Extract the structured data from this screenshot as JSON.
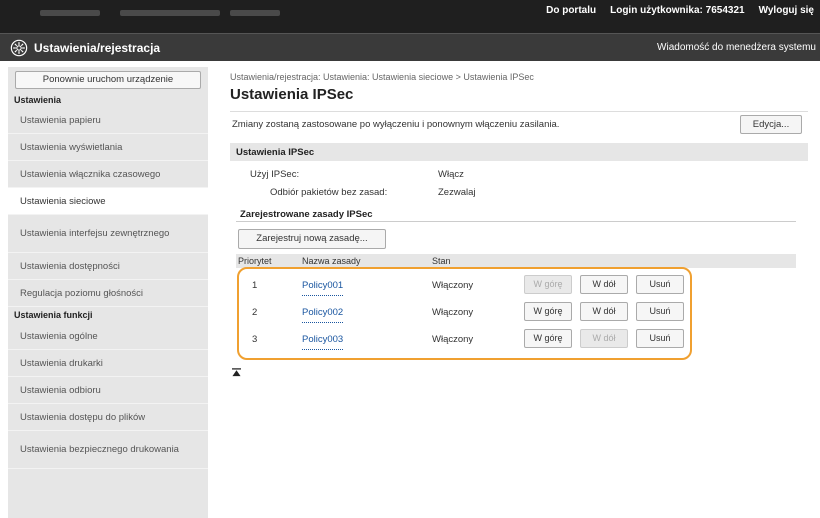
{
  "topbar": {
    "portal_link": "Do portalu",
    "login_label": "Login użytkownika:",
    "login_user": "7654321",
    "logout_link": "Wyloguj się"
  },
  "titlebar": {
    "title": "Ustawienia/rejestracja",
    "message_link": "Wiadomość do menedżera systemu"
  },
  "sidebar": {
    "restart_button": "Ponownie uruchom urządzenie",
    "section_settings": "Ustawienia",
    "settings_items": [
      "Ustawienia papieru",
      "Ustawienia wyświetlania",
      "Ustawienia włącznika czasowego",
      "Ustawienia sieciowe",
      "Ustawienia interfejsu zewnętrznego",
      "Ustawienia dostępności",
      "Regulacja poziomu głośności"
    ],
    "section_functions": "Ustawienia funkcji",
    "function_items": [
      "Ustawienia ogólne",
      "Ustawienia drukarki",
      "Ustawienia odbioru",
      "Ustawienia dostępu do plików",
      "Ustawienia bezpiecznego drukowania"
    ]
  },
  "main": {
    "breadcrumb": "Ustawienia/rejestracja: Ustawienia: Ustawienia sieciowe > Ustawienia IPSec",
    "page_title": "Ustawienia IPSec",
    "notice": "Zmiany zostaną zastosowane po wyłączeniu i ponownym włączeniu zasilania.",
    "edit_button": "Edycja...",
    "section_title": "Ustawienia IPSec",
    "use_ipsec_label": "Użyj IPSec:",
    "use_ipsec_value": "Włącz",
    "receive_label": "Odbiór pakietów bez zasad:",
    "receive_value": "Zezwalaj",
    "registered_heading": "Zarejestrowane zasady IPSec",
    "register_button": "Zarejestruj nową zasadę...",
    "table_headers": {
      "priority": "Priorytet",
      "name": "Nazwa zasady",
      "status": "Stan"
    },
    "rows": [
      {
        "priority": "1",
        "name": "Policy001",
        "status": "Włączony",
        "up": "W górę",
        "down": "W dół",
        "delete": "Usuń"
      },
      {
        "priority": "2",
        "name": "Policy002",
        "status": "Włączony",
        "up": "W górę",
        "down": "W dół",
        "delete": "Usuń"
      },
      {
        "priority": "3",
        "name": "Policy003",
        "status": "Włączony",
        "up": "W górę",
        "down": "W dół",
        "delete": "Usuń"
      }
    ]
  },
  "colors": {
    "highlight": "#f0a030",
    "link": "#1a56a0",
    "topbar": "#1f1f1f",
    "titlebar": "#3a3a3a"
  }
}
